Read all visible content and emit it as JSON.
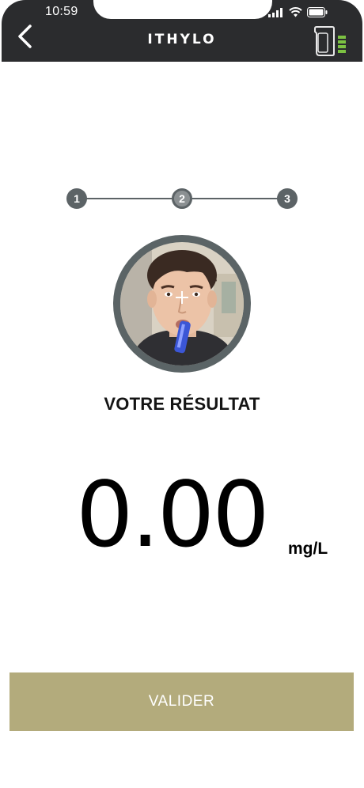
{
  "status_bar": {
    "time": "10:59"
  },
  "header": {
    "title": "ITHYLO",
    "back_icon": "chevron-left-icon",
    "device_icon": "breathalyzer-battery-icon"
  },
  "stepper": {
    "steps": [
      "1",
      "2",
      "3"
    ],
    "current_step": 2
  },
  "result": {
    "label": "VOTRE RÉSULTAT",
    "value": "0.00",
    "unit": "mg/L"
  },
  "actions": {
    "validate_label": "VALIDER"
  },
  "colors": {
    "header_bg": "#2b2c2e",
    "accent": "#b3ab7c",
    "step_gray": "#5c6366",
    "battery_green": "#7cc242"
  }
}
